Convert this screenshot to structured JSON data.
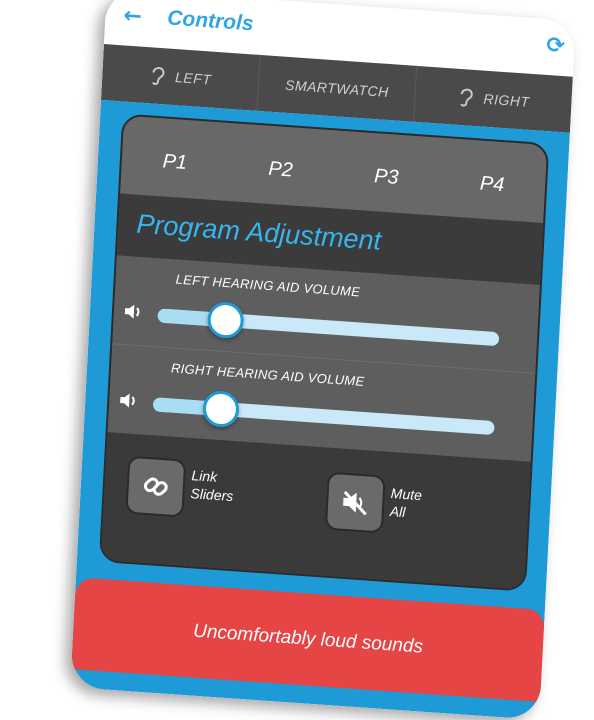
{
  "header": {
    "title": "Controls",
    "back_icon": "back-arrow-icon",
    "right_icon": "refresh-icon"
  },
  "device_tabs": [
    {
      "label": "LEFT",
      "icon": "ear-icon"
    },
    {
      "label": "SMARTWATCH"
    },
    {
      "label": "RIGHT",
      "icon": "ear-icon"
    }
  ],
  "programs": [
    "P1",
    "P2",
    "P3",
    "P4"
  ],
  "section_title": "Program Adjustment",
  "sliders": [
    {
      "label": "LEFT HEARING AID VOLUME",
      "value": 0.2
    },
    {
      "label": "RIGHT HEARING AID VOLUME",
      "value": 0.2
    }
  ],
  "controls": {
    "link_label_1": "Link",
    "link_label_2": "Sliders",
    "mute_label_1": "Mute",
    "mute_label_2": "All"
  },
  "alert": {
    "text": "Uncomfortably loud sounds"
  },
  "colors": {
    "accent": "#1e9ad6",
    "alert": "#e64545",
    "panel": "#5a5a5a"
  }
}
